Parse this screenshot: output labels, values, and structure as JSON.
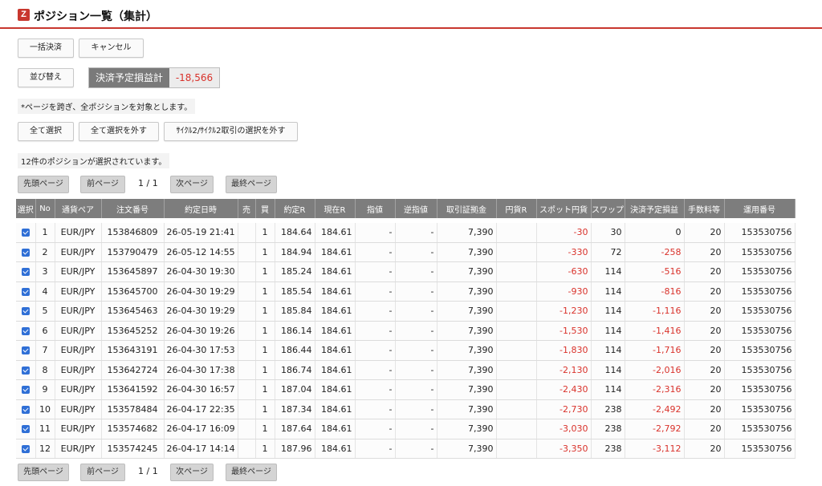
{
  "header": {
    "logo": "Z",
    "title": "ポジション一覧（集計）"
  },
  "actions": {
    "bulk_settle": "一括決済",
    "cancel": "キャンセル",
    "sort": "並び替え",
    "pl_label": "決済予定損益計",
    "pl_value": "-18,566"
  },
  "notes": {
    "cross_page": "*ページを跨ぎ、全ポジションを対象とします。",
    "selected_count": "12件のポジションが選択されています。"
  },
  "selection": {
    "select_all": "全て選択",
    "deselect_all": "全て選択を外す",
    "deselect_cycle": "ｻｲｸﾙ2/ｻｲｸﾙ2取引の選択を外す"
  },
  "pager": {
    "first": "先頭ページ",
    "prev": "前ページ",
    "count": "1 / 1",
    "next": "次ページ",
    "last": "最終ページ"
  },
  "table": {
    "columns": [
      "選択",
      "No",
      "通貨ペア",
      "注文番号",
      "約定日時",
      "売",
      "買",
      "約定R",
      "現在R",
      "指値",
      "逆指値",
      "取引証拠金",
      "円貨R",
      "スポット円貨",
      "スワップ",
      "決済予定損益",
      "手数料等",
      "運用番号"
    ],
    "rows": [
      {
        "no": "1",
        "pair": "EUR/JPY",
        "order": "153846809",
        "datetime": "26-05-19 21:41",
        "sell": "",
        "buy": "1",
        "rate": "184.64",
        "current": "184.61",
        "limit": "-",
        "stop": "-",
        "margin": "7,390",
        "yen_rate": "",
        "spot": "-30",
        "swap": "30",
        "pl": "0",
        "fee": "20",
        "op": "153530756"
      },
      {
        "no": "2",
        "pair": "EUR/JPY",
        "order": "153790479",
        "datetime": "26-05-12 14:55",
        "sell": "",
        "buy": "1",
        "rate": "184.94",
        "current": "184.61",
        "limit": "-",
        "stop": "-",
        "margin": "7,390",
        "yen_rate": "",
        "spot": "-330",
        "swap": "72",
        "pl": "-258",
        "fee": "20",
        "op": "153530756"
      },
      {
        "no": "3",
        "pair": "EUR/JPY",
        "order": "153645897",
        "datetime": "26-04-30 19:30",
        "sell": "",
        "buy": "1",
        "rate": "185.24",
        "current": "184.61",
        "limit": "-",
        "stop": "-",
        "margin": "7,390",
        "yen_rate": "",
        "spot": "-630",
        "swap": "114",
        "pl": "-516",
        "fee": "20",
        "op": "153530756"
      },
      {
        "no": "4",
        "pair": "EUR/JPY",
        "order": "153645700",
        "datetime": "26-04-30 19:29",
        "sell": "",
        "buy": "1",
        "rate": "185.54",
        "current": "184.61",
        "limit": "-",
        "stop": "-",
        "margin": "7,390",
        "yen_rate": "",
        "spot": "-930",
        "swap": "114",
        "pl": "-816",
        "fee": "20",
        "op": "153530756"
      },
      {
        "no": "5",
        "pair": "EUR/JPY",
        "order": "153645463",
        "datetime": "26-04-30 19:29",
        "sell": "",
        "buy": "1",
        "rate": "185.84",
        "current": "184.61",
        "limit": "-",
        "stop": "-",
        "margin": "7,390",
        "yen_rate": "",
        "spot": "-1,230",
        "swap": "114",
        "pl": "-1,116",
        "fee": "20",
        "op": "153530756"
      },
      {
        "no": "6",
        "pair": "EUR/JPY",
        "order": "153645252",
        "datetime": "26-04-30 19:26",
        "sell": "",
        "buy": "1",
        "rate": "186.14",
        "current": "184.61",
        "limit": "-",
        "stop": "-",
        "margin": "7,390",
        "yen_rate": "",
        "spot": "-1,530",
        "swap": "114",
        "pl": "-1,416",
        "fee": "20",
        "op": "153530756"
      },
      {
        "no": "7",
        "pair": "EUR/JPY",
        "order": "153643191",
        "datetime": "26-04-30 17:53",
        "sell": "",
        "buy": "1",
        "rate": "186.44",
        "current": "184.61",
        "limit": "-",
        "stop": "-",
        "margin": "7,390",
        "yen_rate": "",
        "spot": "-1,830",
        "swap": "114",
        "pl": "-1,716",
        "fee": "20",
        "op": "153530756"
      },
      {
        "no": "8",
        "pair": "EUR/JPY",
        "order": "153642724",
        "datetime": "26-04-30 17:38",
        "sell": "",
        "buy": "1",
        "rate": "186.74",
        "current": "184.61",
        "limit": "-",
        "stop": "-",
        "margin": "7,390",
        "yen_rate": "",
        "spot": "-2,130",
        "swap": "114",
        "pl": "-2,016",
        "fee": "20",
        "op": "153530756"
      },
      {
        "no": "9",
        "pair": "EUR/JPY",
        "order": "153641592",
        "datetime": "26-04-30 16:57",
        "sell": "",
        "buy": "1",
        "rate": "187.04",
        "current": "184.61",
        "limit": "-",
        "stop": "-",
        "margin": "7,390",
        "yen_rate": "",
        "spot": "-2,430",
        "swap": "114",
        "pl": "-2,316",
        "fee": "20",
        "op": "153530756"
      },
      {
        "no": "10",
        "pair": "EUR/JPY",
        "order": "153578484",
        "datetime": "26-04-17 22:35",
        "sell": "",
        "buy": "1",
        "rate": "187.34",
        "current": "184.61",
        "limit": "-",
        "stop": "-",
        "margin": "7,390",
        "yen_rate": "",
        "spot": "-2,730",
        "swap": "238",
        "pl": "-2,492",
        "fee": "20",
        "op": "153530756"
      },
      {
        "no": "11",
        "pair": "EUR/JPY",
        "order": "153574682",
        "datetime": "26-04-17 16:09",
        "sell": "",
        "buy": "1",
        "rate": "187.64",
        "current": "184.61",
        "limit": "-",
        "stop": "-",
        "margin": "7,390",
        "yen_rate": "",
        "spot": "-3,030",
        "swap": "238",
        "pl": "-2,792",
        "fee": "20",
        "op": "153530756"
      },
      {
        "no": "12",
        "pair": "EUR/JPY",
        "order": "153574245",
        "datetime": "26-04-17 14:14",
        "sell": "",
        "buy": "1",
        "rate": "187.96",
        "current": "184.61",
        "limit": "-",
        "stop": "-",
        "margin": "7,390",
        "yen_rate": "",
        "spot": "-3,350",
        "swap": "238",
        "pl": "-3,112",
        "fee": "20",
        "op": "153530756"
      }
    ]
  },
  "colors": {
    "accent": "#c8372e",
    "negative": "#d9322b",
    "checkbox": "#2f6fd6",
    "header_bg": "#7d7d7d"
  },
  "icons": {
    "logo": "z-logo-icon",
    "checkbox": "checkbox-checked-icon"
  }
}
